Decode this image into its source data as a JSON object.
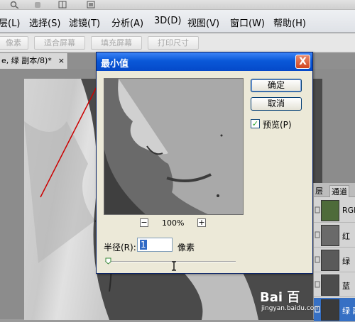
{
  "menu": {
    "items": [
      "层(L)",
      "选择(S)",
      "滤镜(T)",
      "分析(A)",
      "3D(D)",
      "视图(V)",
      "窗口(W)",
      "帮助(H)"
    ]
  },
  "options": {
    "buttons": [
      "像素",
      "适合屏幕",
      "填充屏幕",
      "打印尺寸"
    ]
  },
  "document": {
    "tab_label": "e, 绿 副本/8)*",
    "close_label": "×"
  },
  "dialog": {
    "title": "最小值",
    "close_label": "X",
    "ok_label": "确定",
    "cancel_label": "取消",
    "preview_label": "预览(P)",
    "preview_checked": true,
    "zoom_minus": "−",
    "zoom_plus": "+",
    "zoom_value": "100%",
    "radius_label": "半径(R):",
    "radius_value": "1",
    "radius_unit": "像素"
  },
  "panel": {
    "tabs": [
      "层",
      "通道"
    ],
    "channels": [
      {
        "label": "RGB",
        "selected": false
      },
      {
        "label": "红",
        "selected": false
      },
      {
        "label": "绿",
        "selected": false
      },
      {
        "label": "蓝",
        "selected": false
      },
      {
        "label": "绿 副",
        "selected": true
      }
    ]
  },
  "watermark": {
    "logo": "Bai 百",
    "url": "jingyan.baidu.com"
  },
  "colors": {
    "titlebar": "#0a58d8",
    "annotation_arrow": "#cc0000",
    "selected_row": "#3670c4"
  }
}
